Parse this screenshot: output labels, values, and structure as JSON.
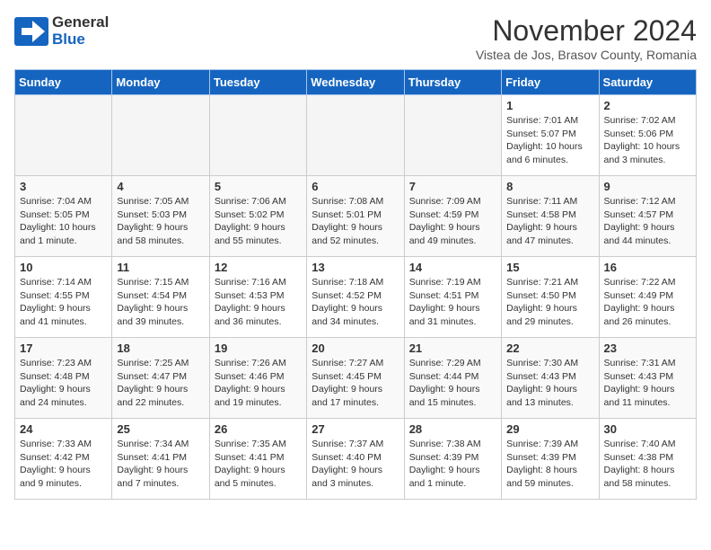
{
  "header": {
    "logo_general": "General",
    "logo_blue": "Blue",
    "month_title": "November 2024",
    "subtitle": "Vistea de Jos, Brasov County, Romania"
  },
  "weekdays": [
    "Sunday",
    "Monday",
    "Tuesday",
    "Wednesday",
    "Thursday",
    "Friday",
    "Saturday"
  ],
  "weeks": [
    [
      {
        "day": "",
        "info": ""
      },
      {
        "day": "",
        "info": ""
      },
      {
        "day": "",
        "info": ""
      },
      {
        "day": "",
        "info": ""
      },
      {
        "day": "",
        "info": ""
      },
      {
        "day": "1",
        "info": "Sunrise: 7:01 AM\nSunset: 5:07 PM\nDaylight: 10 hours and 6 minutes."
      },
      {
        "day": "2",
        "info": "Sunrise: 7:02 AM\nSunset: 5:06 PM\nDaylight: 10 hours and 3 minutes."
      }
    ],
    [
      {
        "day": "3",
        "info": "Sunrise: 7:04 AM\nSunset: 5:05 PM\nDaylight: 10 hours and 1 minute."
      },
      {
        "day": "4",
        "info": "Sunrise: 7:05 AM\nSunset: 5:03 PM\nDaylight: 9 hours and 58 minutes."
      },
      {
        "day": "5",
        "info": "Sunrise: 7:06 AM\nSunset: 5:02 PM\nDaylight: 9 hours and 55 minutes."
      },
      {
        "day": "6",
        "info": "Sunrise: 7:08 AM\nSunset: 5:01 PM\nDaylight: 9 hours and 52 minutes."
      },
      {
        "day": "7",
        "info": "Sunrise: 7:09 AM\nSunset: 4:59 PM\nDaylight: 9 hours and 49 minutes."
      },
      {
        "day": "8",
        "info": "Sunrise: 7:11 AM\nSunset: 4:58 PM\nDaylight: 9 hours and 47 minutes."
      },
      {
        "day": "9",
        "info": "Sunrise: 7:12 AM\nSunset: 4:57 PM\nDaylight: 9 hours and 44 minutes."
      }
    ],
    [
      {
        "day": "10",
        "info": "Sunrise: 7:14 AM\nSunset: 4:55 PM\nDaylight: 9 hours and 41 minutes."
      },
      {
        "day": "11",
        "info": "Sunrise: 7:15 AM\nSunset: 4:54 PM\nDaylight: 9 hours and 39 minutes."
      },
      {
        "day": "12",
        "info": "Sunrise: 7:16 AM\nSunset: 4:53 PM\nDaylight: 9 hours and 36 minutes."
      },
      {
        "day": "13",
        "info": "Sunrise: 7:18 AM\nSunset: 4:52 PM\nDaylight: 9 hours and 34 minutes."
      },
      {
        "day": "14",
        "info": "Sunrise: 7:19 AM\nSunset: 4:51 PM\nDaylight: 9 hours and 31 minutes."
      },
      {
        "day": "15",
        "info": "Sunrise: 7:21 AM\nSunset: 4:50 PM\nDaylight: 9 hours and 29 minutes."
      },
      {
        "day": "16",
        "info": "Sunrise: 7:22 AM\nSunset: 4:49 PM\nDaylight: 9 hours and 26 minutes."
      }
    ],
    [
      {
        "day": "17",
        "info": "Sunrise: 7:23 AM\nSunset: 4:48 PM\nDaylight: 9 hours and 24 minutes."
      },
      {
        "day": "18",
        "info": "Sunrise: 7:25 AM\nSunset: 4:47 PM\nDaylight: 9 hours and 22 minutes."
      },
      {
        "day": "19",
        "info": "Sunrise: 7:26 AM\nSunset: 4:46 PM\nDaylight: 9 hours and 19 minutes."
      },
      {
        "day": "20",
        "info": "Sunrise: 7:27 AM\nSunset: 4:45 PM\nDaylight: 9 hours and 17 minutes."
      },
      {
        "day": "21",
        "info": "Sunrise: 7:29 AM\nSunset: 4:44 PM\nDaylight: 9 hours and 15 minutes."
      },
      {
        "day": "22",
        "info": "Sunrise: 7:30 AM\nSunset: 4:43 PM\nDaylight: 9 hours and 13 minutes."
      },
      {
        "day": "23",
        "info": "Sunrise: 7:31 AM\nSunset: 4:43 PM\nDaylight: 9 hours and 11 minutes."
      }
    ],
    [
      {
        "day": "24",
        "info": "Sunrise: 7:33 AM\nSunset: 4:42 PM\nDaylight: 9 hours and 9 minutes."
      },
      {
        "day": "25",
        "info": "Sunrise: 7:34 AM\nSunset: 4:41 PM\nDaylight: 9 hours and 7 minutes."
      },
      {
        "day": "26",
        "info": "Sunrise: 7:35 AM\nSunset: 4:41 PM\nDaylight: 9 hours and 5 minutes."
      },
      {
        "day": "27",
        "info": "Sunrise: 7:37 AM\nSunset: 4:40 PM\nDaylight: 9 hours and 3 minutes."
      },
      {
        "day": "28",
        "info": "Sunrise: 7:38 AM\nSunset: 4:39 PM\nDaylight: 9 hours and 1 minute."
      },
      {
        "day": "29",
        "info": "Sunrise: 7:39 AM\nSunset: 4:39 PM\nDaylight: 8 hours and 59 minutes."
      },
      {
        "day": "30",
        "info": "Sunrise: 7:40 AM\nSunset: 4:38 PM\nDaylight: 8 hours and 58 minutes."
      }
    ]
  ]
}
